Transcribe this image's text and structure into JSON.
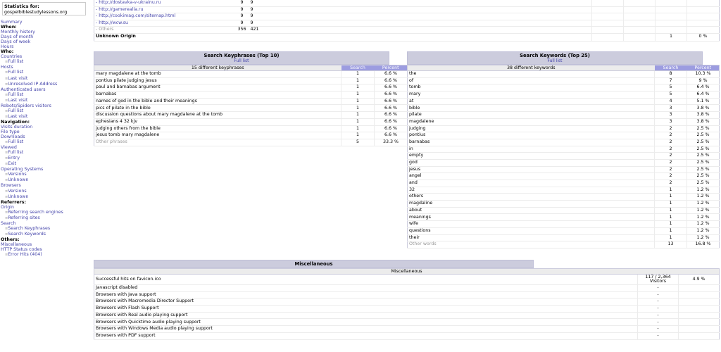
{
  "site": {
    "label": "Statistics for:",
    "domain": "gospelbiblestudylessons.org"
  },
  "menu": [
    {
      "t": "Summary",
      "k": "link"
    },
    {
      "t": "When:",
      "k": "h"
    },
    {
      "t": "Monthly history",
      "k": "link"
    },
    {
      "t": "Days of month",
      "k": "link"
    },
    {
      "t": "Days of week",
      "k": "link"
    },
    {
      "t": "Hours",
      "k": "link"
    },
    {
      "t": "Who:",
      "k": "h"
    },
    {
      "t": "Countries",
      "k": "link"
    },
    {
      "t": "Full list",
      "k": "sub"
    },
    {
      "t": "Hosts",
      "k": "link"
    },
    {
      "t": "Full list",
      "k": "sub"
    },
    {
      "t": "Last visit",
      "k": "sub"
    },
    {
      "t": "Unresolved IP Address",
      "k": "sub"
    },
    {
      "t": "Authenticated users",
      "k": "link"
    },
    {
      "t": "Full list",
      "k": "sub"
    },
    {
      "t": "Last visit",
      "k": "sub"
    },
    {
      "t": "Robots/Spiders visitors",
      "k": "link"
    },
    {
      "t": "Full list",
      "k": "sub"
    },
    {
      "t": "Last visit",
      "k": "sub"
    },
    {
      "t": "Navigation:",
      "k": "h"
    },
    {
      "t": "Visits duration",
      "k": "link"
    },
    {
      "t": "File type",
      "k": "link"
    },
    {
      "t": "Downloads",
      "k": "link"
    },
    {
      "t": "Full list",
      "k": "sub"
    },
    {
      "t": "Viewed",
      "k": "link"
    },
    {
      "t": "Full list",
      "k": "sub"
    },
    {
      "t": "Entry",
      "k": "sub"
    },
    {
      "t": "Exit",
      "k": "sub"
    },
    {
      "t": "Operating Systems",
      "k": "link"
    },
    {
      "t": "Versions",
      "k": "sub"
    },
    {
      "t": "Unknown",
      "k": "sub"
    },
    {
      "t": "Browsers",
      "k": "link"
    },
    {
      "t": "Versions",
      "k": "sub"
    },
    {
      "t": "Unknown",
      "k": "sub"
    },
    {
      "t": "Referrers:",
      "k": "h"
    },
    {
      "t": "Origin",
      "k": "link"
    },
    {
      "t": "Referring search engines",
      "k": "sub"
    },
    {
      "t": "Referring sites",
      "k": "sub"
    },
    {
      "t": "Search",
      "k": "link"
    },
    {
      "t": "Search Keyphrases",
      "k": "sub"
    },
    {
      "t": "Search Keywords",
      "k": "sub"
    },
    {
      "t": "Others:",
      "k": "h"
    },
    {
      "t": "Miscellaneous",
      "k": "link"
    },
    {
      "t": "HTTP Status codes",
      "k": "link"
    },
    {
      "t": "Error Hits (404)",
      "k": "sub"
    }
  ],
  "referrers": {
    "rows": [
      [
        "- http://dostavka-v-ukrainu.ru",
        "9",
        "9"
      ],
      [
        "- http://gamerealla.ru",
        "9",
        "9"
      ],
      [
        "- http://cookimag.com/sitemap.html",
        "9",
        "9"
      ],
      [
        "- http://wcw.su",
        "9",
        "9"
      ],
      [
        "- Others",
        "356",
        "421"
      ]
    ],
    "unknown": {
      "label": "Unknown Origin",
      "value": "1",
      "percent": "0 %"
    }
  },
  "keyphrases": {
    "title": "Search Keyphrases (Top 10)",
    "full_list": "Full list",
    "count_label": "15 different keyphrases",
    "col_search": "Search",
    "col_percent": "Percent",
    "rows": [
      [
        "mary magdalene at the tomb",
        "1",
        "6.6 %"
      ],
      [
        "pontius pilate judging jesus",
        "1",
        "6.6 %"
      ],
      [
        "paul and barnabas argument",
        "1",
        "6.6 %"
      ],
      [
        "barnabas",
        "1",
        "6.6 %"
      ],
      [
        "names of god in the bible and their meanings",
        "1",
        "6.6 %"
      ],
      [
        "pics of pilate in the bible",
        "1",
        "6.6 %"
      ],
      [
        "discussion questions about mary magdalene at the tomb",
        "1",
        "6.6 %"
      ],
      [
        "ephesians 4 32 kjv",
        "1",
        "6.6 %"
      ],
      [
        "judging others from the bible",
        "1",
        "6.6 %"
      ],
      [
        "jesus tomb mary magdalene",
        "1",
        "6.6 %"
      ]
    ],
    "other": [
      "Other phrases",
      "5",
      "33.3 %"
    ]
  },
  "keywords": {
    "title": "Search Keywords (Top 25)",
    "full_list": "Full list",
    "count_label": "38 different keywords",
    "col_search": "Search",
    "col_percent": "Percent",
    "rows": [
      [
        "the",
        "8",
        "10.3 %"
      ],
      [
        "of",
        "7",
        "9 %"
      ],
      [
        "tomb",
        "5",
        "6.4 %"
      ],
      [
        "mary",
        "5",
        "6.4 %"
      ],
      [
        "at",
        "4",
        "5.1 %"
      ],
      [
        "bible",
        "3",
        "3.8 %"
      ],
      [
        "pilate",
        "3",
        "3.8 %"
      ],
      [
        "magdalene",
        "3",
        "3.8 %"
      ],
      [
        "judging",
        "2",
        "2.5 %"
      ],
      [
        "pontius",
        "2",
        "2.5 %"
      ],
      [
        "barnabas",
        "2",
        "2.5 %"
      ],
      [
        "in",
        "2",
        "2.5 %"
      ],
      [
        "empty",
        "2",
        "2.5 %"
      ],
      [
        "god",
        "2",
        "2.5 %"
      ],
      [
        "jesus",
        "2",
        "2.5 %"
      ],
      [
        "angel",
        "2",
        "2.5 %"
      ],
      [
        "and",
        "2",
        "2.5 %"
      ],
      [
        "32",
        "1",
        "1.2 %"
      ],
      [
        "others",
        "1",
        "1.2 %"
      ],
      [
        "magdaline",
        "1",
        "1.2 %"
      ],
      [
        "about",
        "1",
        "1.2 %"
      ],
      [
        "meanings",
        "1",
        "1.2 %"
      ],
      [
        "wife",
        "1",
        "1.2 %"
      ],
      [
        "questions",
        "1",
        "1.2 %"
      ],
      [
        "their",
        "1",
        "1.2 %"
      ]
    ],
    "other": [
      "Other words",
      "13",
      "16.8 %"
    ]
  },
  "misc": {
    "title": "Miscellaneous",
    "subheader": "Miscellaneous",
    "favicon": {
      "label": "Successful hits on favicon.ico",
      "value": "117 / 2,364",
      "unit": "Visitors",
      "percent": "4.9 %"
    },
    "rows": [
      [
        "Javascript disabled",
        "-"
      ],
      [
        "Browsers with Java support",
        "-"
      ],
      [
        "Browsers with Macromedia Director Support",
        "-"
      ],
      [
        "Browsers with Flash Support",
        "-"
      ],
      [
        "Browsers with Real audio playing support",
        "-"
      ],
      [
        "Browsers with Quicktime audio playing support",
        "-"
      ],
      [
        "Browsers with Windows Media audio playing support",
        "-"
      ],
      [
        "Browsers with PDF support",
        "-"
      ]
    ]
  }
}
